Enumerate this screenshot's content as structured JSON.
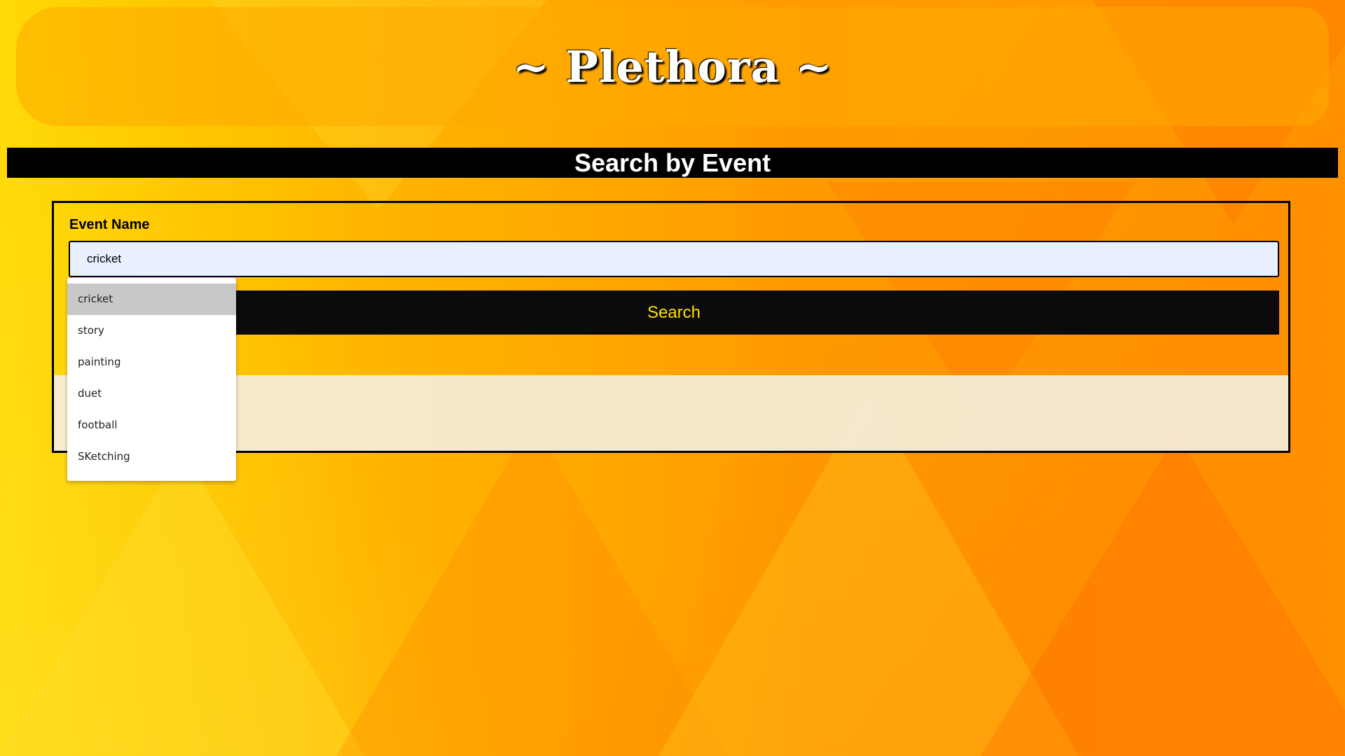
{
  "header": {
    "title": "~ Plethora ~"
  },
  "section": {
    "title": "Search by Event"
  },
  "form": {
    "label": "Event Name",
    "input_value": "cricket",
    "button_label": "Search"
  },
  "autocomplete": {
    "items": [
      {
        "label": "cricket",
        "highlighted": true
      },
      {
        "label": "story",
        "highlighted": false
      },
      {
        "label": "painting",
        "highlighted": false
      },
      {
        "label": "duet",
        "highlighted": false
      },
      {
        "label": "football",
        "highlighted": false
      },
      {
        "label": "SKetching",
        "highlighted": false
      }
    ]
  },
  "colors": {
    "button_bg": "#0b0b0b",
    "button_text": "#ffe000",
    "input_bg": "#e8f0fe",
    "highlight_bg": "#c8c8c8"
  }
}
